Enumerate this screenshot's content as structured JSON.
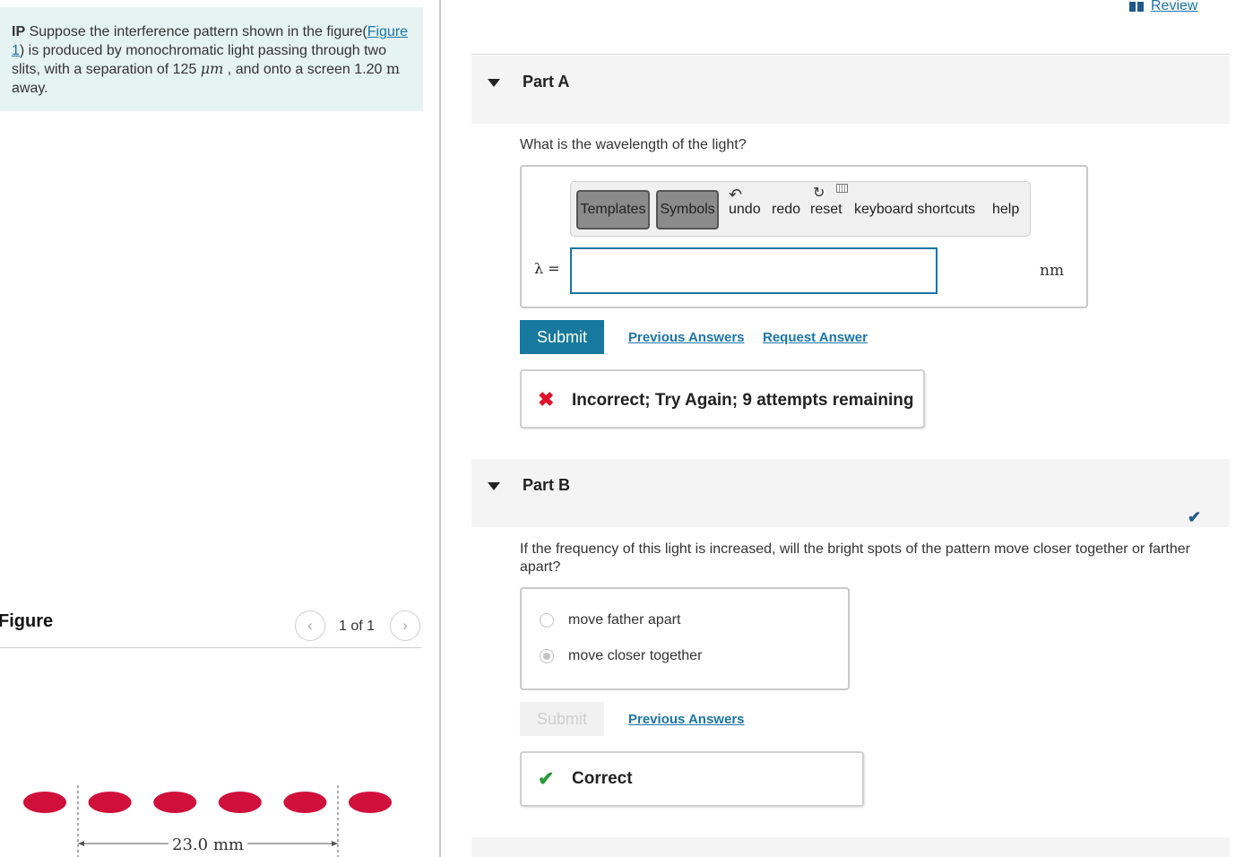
{
  "problem": {
    "label": "IP",
    "text_a": " Suppose the interference pattern shown in the figure(",
    "figure_link": "Figure 1",
    "text_b": ") is produced by monochromatic light passing through two slits, with a separation of 125 ",
    "unit_um": "μm",
    "text_c": " , and onto a screen 1.20 ",
    "unit_m": "m",
    "text_d": " away."
  },
  "figure": {
    "title": "Figure",
    "page_count": "1 of 1",
    "prev_icon": "chevron-left-icon",
    "next_icon": "chevron-right-icon",
    "spot_color": "#d0103a",
    "dimension_label": "23.0 mm"
  },
  "header": {
    "review_label": "Review",
    "review_icon": "book-icon"
  },
  "part_a": {
    "title": "Part A",
    "question": "What is the wavelength of the light?",
    "toolbar": {
      "templates": "Templates",
      "symbols": "Symbols",
      "undo": "undo",
      "redo": "redo",
      "reset": "reset",
      "keyboard": "keyboard shortcuts",
      "help": "help"
    },
    "input_label": "λ =",
    "input_value": "",
    "unit": "nm",
    "submit": "Submit",
    "previous_answers": "Previous Answers",
    "request_answer": "Request Answer",
    "feedback_icon": "x-icon",
    "feedback": "Incorrect; Try Again; 9 attempts remaining",
    "feedback_color": "#e0102a"
  },
  "part_b": {
    "title": "Part B",
    "question": "If the frequency of this light is increased, will the bright spots of the pattern move closer together or farther apart?",
    "choices": [
      "move father apart",
      "move closer together"
    ],
    "selected_index": 1,
    "submit": "Submit",
    "previous_answers": "Previous Answers",
    "feedback_icon": "check-icon",
    "feedback": "Correct",
    "feedback_color": "#2a9a3a"
  },
  "colors": {
    "accent": "#16799d",
    "link": "#1a75a8",
    "problem_bg": "#e6f3f3",
    "part_header_bg": "#f4f4f4"
  }
}
